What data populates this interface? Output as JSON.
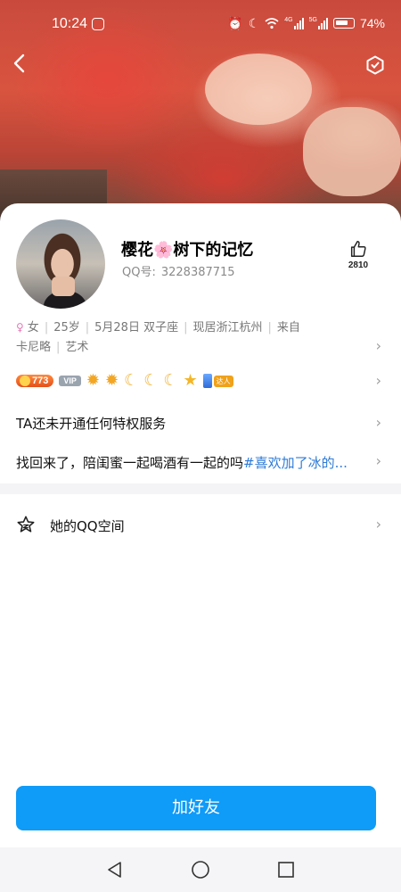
{
  "status_bar": {
    "time": "10:24",
    "battery": "74%",
    "icons": [
      "hd-icon",
      "alarm-icon",
      "moon-icon",
      "wifi-icon",
      "signal-4g-icon",
      "signal-5g-icon",
      "battery-icon"
    ],
    "net_a": "4G",
    "net_b": "5G"
  },
  "header": {
    "back_icon": "chevron-left-icon",
    "more_icon": "hexagon-icon"
  },
  "profile": {
    "nickname_part1": "樱花",
    "nickname_emoji": "🌸",
    "nickname_part2": "树下的记忆",
    "qq_label": "QQ号:",
    "qq_number": "3228387715",
    "likes": "2810"
  },
  "info": {
    "gender": "女",
    "age": "25岁",
    "birthday": "5月28日",
    "zodiac": "双子座",
    "location": "现居浙江杭州",
    "from_label": "来自",
    "hometown": "卡尼略",
    "occupation": "艺术"
  },
  "badges": {
    "level": "773",
    "vip": "VIP",
    "level_glyphs": [
      "sun",
      "sun",
      "moon",
      "moon",
      "moon",
      "star"
    ],
    "phone_tag": "达人"
  },
  "privilege_text": "TA还未开通任何特权服务",
  "signature": {
    "text": "找回来了，陪闺蜜一起喝酒有一起的吗",
    "hashtag": "#喜欢加了冰的..."
  },
  "qzone_label": "她的QQ空间",
  "add_friend_label": "加好友",
  "colors": {
    "accent": "#0f9bf8",
    "hashtag": "#2e7bd6",
    "level_badge": "#e34f1b"
  }
}
